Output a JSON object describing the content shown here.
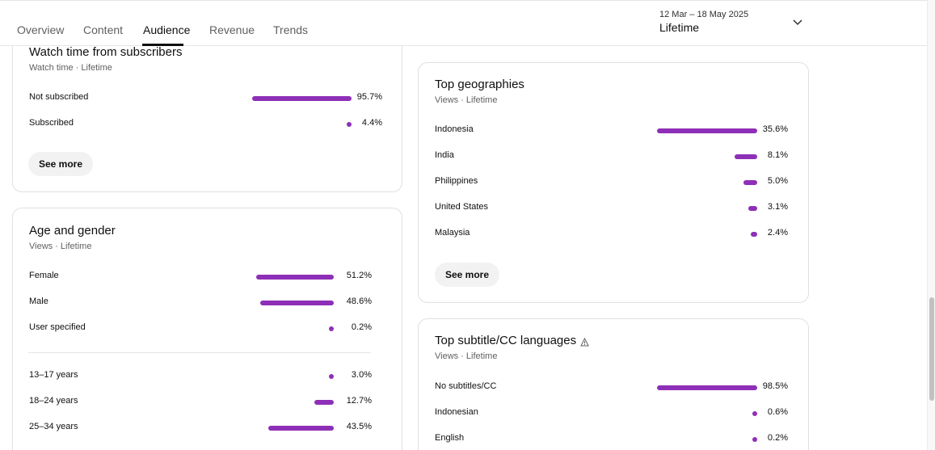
{
  "tabs": [
    {
      "label": "Overview"
    },
    {
      "label": "Content"
    },
    {
      "label": "Audience"
    },
    {
      "label": "Revenue"
    },
    {
      "label": "Trends"
    }
  ],
  "active_tab": "Audience",
  "date_picker": {
    "range": "12 Mar – 18 May 2025",
    "period": "Lifetime"
  },
  "watch_time": {
    "title": "Watch time from subscribers",
    "subtitle": "Watch time · Lifetime",
    "rows": [
      {
        "label": "Not subscribed",
        "value": "95.7%",
        "pct": 95.7
      },
      {
        "label": "Subscribed",
        "value": "4.4%",
        "pct": 4.4
      }
    ],
    "see_more": "See more"
  },
  "age_gender": {
    "title": "Age and gender",
    "subtitle": "Views · Lifetime",
    "gender_rows": [
      {
        "label": "Female",
        "value": "51.2%",
        "pct": 51.2
      },
      {
        "label": "Male",
        "value": "48.6%",
        "pct": 48.6
      },
      {
        "label": "User specified",
        "value": "0.2%",
        "pct": 0.2
      }
    ],
    "age_rows": [
      {
        "label": "13–17 years",
        "value": "3.0%",
        "pct": 3.0
      },
      {
        "label": "18–24 years",
        "value": "12.7%",
        "pct": 12.7
      },
      {
        "label": "25–34 years",
        "value": "43.5%",
        "pct": 43.5
      }
    ]
  },
  "geographies": {
    "title": "Top geographies",
    "subtitle": "Views · Lifetime",
    "rows": [
      {
        "label": "Indonesia",
        "value": "35.6%",
        "pct": 35.6
      },
      {
        "label": "India",
        "value": "8.1%",
        "pct": 8.1
      },
      {
        "label": "Philippines",
        "value": "5.0%",
        "pct": 5.0
      },
      {
        "label": "United States",
        "value": "3.1%",
        "pct": 3.1
      },
      {
        "label": "Malaysia",
        "value": "2.4%",
        "pct": 2.4
      }
    ],
    "see_more": "See more"
  },
  "subtitles": {
    "title": "Top subtitle/CC languages",
    "subtitle": "Views · Lifetime",
    "rows": [
      {
        "label": "No subtitles/CC",
        "value": "98.5%",
        "pct": 98.5
      },
      {
        "label": "Indonesian",
        "value": "0.6%",
        "pct": 0.6
      },
      {
        "label": "English",
        "value": "0.2%",
        "pct": 0.2
      }
    ]
  },
  "colors": {
    "bar": "#8e2fb7",
    "text": "#0f0f0f",
    "muted": "#606060"
  },
  "icons": {
    "dropdown": "chevron-down-icon",
    "warning": "warning-icon"
  }
}
